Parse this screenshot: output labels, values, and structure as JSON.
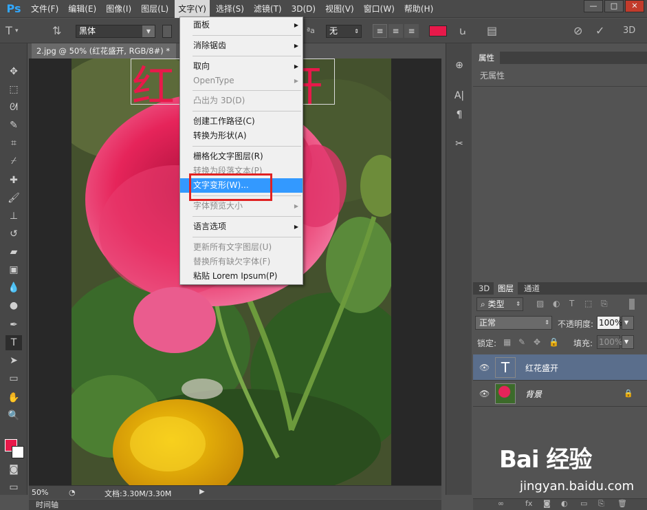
{
  "menubar": {
    "logo": "Ps",
    "items": [
      "文件(F)",
      "编辑(E)",
      "图像(I)",
      "图层(L)",
      "文字(Y)",
      "选择(S)",
      "滤镜(T)",
      "3D(D)",
      "视图(V)",
      "窗口(W)",
      "帮助(H)"
    ],
    "active_index": 4
  },
  "options": {
    "font_family": "黑体",
    "antialias": "无",
    "text_color": "#e8194a",
    "mode_3d": "3D"
  },
  "document": {
    "tab_title": "2.jpg @ 50% (红花盛开, RGB/8#) *",
    "close_label": "×",
    "text_layer_content": "红花盛开",
    "zoom": "50%",
    "doc_info": "文档:3.30M/3.30M",
    "timeline_label": "时间轴"
  },
  "dropdown": {
    "items": [
      {
        "label": "面板",
        "submenu": true,
        "disabled": false
      },
      {
        "label": "消除锯齿",
        "submenu": true,
        "disabled": false
      },
      {
        "label": "取向",
        "submenu": true,
        "disabled": false
      },
      {
        "label": "OpenType",
        "submenu": true,
        "disabled": true
      },
      {
        "label": "凸出为 3D(D)",
        "submenu": false,
        "disabled": true
      },
      {
        "label": "创建工作路径(C)",
        "submenu": false,
        "disabled": false
      },
      {
        "label": "转换为形状(A)",
        "submenu": false,
        "disabled": false
      },
      {
        "label": "栅格化文字图层(R)",
        "submenu": false,
        "disabled": false
      },
      {
        "label": "转换为段落文本(P)",
        "submenu": false,
        "disabled": true
      },
      {
        "label": "文字变形(W)...",
        "submenu": false,
        "disabled": false,
        "highlighted": true
      },
      {
        "label": "字体预览大小",
        "submenu": true,
        "disabled": true
      },
      {
        "label": "语言选项",
        "submenu": true,
        "disabled": false
      },
      {
        "label": "更新所有文字图层(U)",
        "submenu": false,
        "disabled": true
      },
      {
        "label": "替换所有缺欠字体(F)",
        "submenu": false,
        "disabled": true
      },
      {
        "label": "粘贴 Lorem Ipsum(P)",
        "submenu": false,
        "disabled": false
      }
    ]
  },
  "properties": {
    "tab": "属性",
    "empty_text": "无属性"
  },
  "layers": {
    "tabs": [
      "3D",
      "图层",
      "通道"
    ],
    "active_tab": 1,
    "filter_kind": "类型",
    "blend_mode": "正常",
    "opacity_label": "不透明度:",
    "opacity_value": "100%",
    "lock_label": "锁定:",
    "fill_label": "填充:",
    "fill_value": "100%",
    "items": [
      {
        "name": "红花盛开",
        "type": "text",
        "selected": true
      },
      {
        "name": "背景",
        "type": "image",
        "locked": true
      }
    ]
  },
  "watermark": {
    "brand": "Bai 经验",
    "url": "jingyan.baidu.com"
  },
  "colors": {
    "accent_red": "#e8194a",
    "menu_highlight": "#3399ff",
    "selection_box": "#e02222"
  }
}
